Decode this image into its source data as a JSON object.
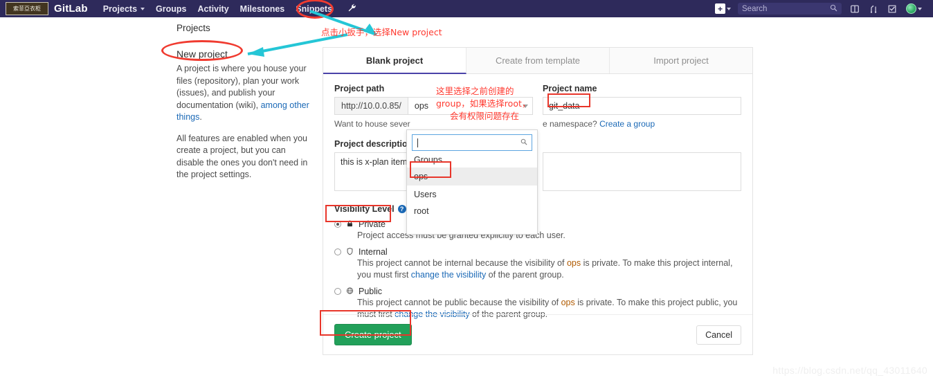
{
  "navbar": {
    "logo_text": "索菲亞衣柜",
    "brand": "GitLab",
    "items": [
      {
        "label": "Projects",
        "has_caret": true
      },
      {
        "label": "Groups",
        "has_caret": false
      },
      {
        "label": "Activity",
        "has_caret": false
      },
      {
        "label": "Milestones",
        "has_caret": false
      },
      {
        "label": "Snippets",
        "has_caret": false
      }
    ],
    "wrench_icon": "wrench-icon",
    "plus_label": "+",
    "search_placeholder": "Search",
    "search_value": "",
    "icons": [
      "issues-board-icon",
      "merge-requests-icon",
      "todos-icon"
    ],
    "avatar": "user-avatar"
  },
  "sidebar": {
    "heading": "Projects",
    "subheading": "New project",
    "paragraph1_a": "A project is where you house your files (repository), plan your work (issues), and publish your documentation (wiki), ",
    "paragraph1_link": "among other things",
    "paragraph1_b": ".",
    "paragraph2": "All features are enabled when you create a project, but you can disable the ones you don't need in the project settings."
  },
  "panel": {
    "tabs": [
      {
        "label": "Blank project",
        "active": true
      },
      {
        "label": "Create from template",
        "active": false
      },
      {
        "label": "Import project",
        "active": false
      }
    ],
    "project_path": {
      "label": "Project path",
      "prefix": "http://10.0.0.85/",
      "selected_namespace": "ops",
      "hint_a": "Want to house sever",
      "hint_b": "e namespace? ",
      "hint_link": "Create a group"
    },
    "project_name": {
      "label": "Project name",
      "value": "git_data",
      "placeholder": ""
    },
    "project_description": {
      "label": "Project description (",
      "value": "this is x-plan item",
      "placeholder": ""
    },
    "right_textarea": {
      "value": "",
      "placeholder": ""
    },
    "visibility": {
      "title": "Visibility Level",
      "help_glyph": "?",
      "options": [
        {
          "name": "Private",
          "icon": "lock-icon",
          "glyph": "🔒",
          "selected": true,
          "desc_parts": [
            {
              "t": "Project access must be granted explicitly to each user.",
              "k": "text"
            }
          ]
        },
        {
          "name": "Internal",
          "icon": "shield-icon",
          "glyph": "🛡",
          "selected": false,
          "desc_parts": [
            {
              "t": "This project cannot be internal because the visibility of ",
              "k": "text"
            },
            {
              "t": "ops",
              "k": "ops"
            },
            {
              "t": " is private. To make this project internal, you must first ",
              "k": "text"
            },
            {
              "t": "change the visibility",
              "k": "link"
            },
            {
              "t": " of the parent group.",
              "k": "text"
            }
          ]
        },
        {
          "name": "Public",
          "icon": "globe-icon",
          "glyph": "🌐",
          "selected": false,
          "desc_parts": [
            {
              "t": "This project cannot be public because the visibility of ",
              "k": "text"
            },
            {
              "t": "ops",
              "k": "ops"
            },
            {
              "t": " is private. To make this project public, you must first ",
              "k": "text"
            },
            {
              "t": "change the visibility",
              "k": "link"
            },
            {
              "t": " of the parent group.",
              "k": "text"
            }
          ]
        }
      ]
    },
    "actions": {
      "create_label": "Create project",
      "cancel_label": "Cancel"
    }
  },
  "dropdown": {
    "search_value": "",
    "search_placeholder": "",
    "sections": [
      {
        "header": "Groups",
        "items": [
          {
            "label": "ops",
            "highlighted": true
          }
        ]
      },
      {
        "header": "Users",
        "items": [
          {
            "label": "root",
            "highlighted": false
          }
        ]
      }
    ]
  },
  "annotations": {
    "top_note": "点击小扳手，选择New project",
    "namespace_note_line1": "这里选择之前创建的",
    "namespace_note_line2": "group，如果选择root，",
    "namespace_note_line3": "会有权限问题存在"
  },
  "watermark": "https://blog.csdn.net/qq_43011640",
  "colors": {
    "navbar_bg": "#2e2a5b",
    "accent_red": "#e8352a",
    "accent_teal": "#25c6d6",
    "create_green": "#22a05a",
    "link_blue": "#1b69b6"
  }
}
